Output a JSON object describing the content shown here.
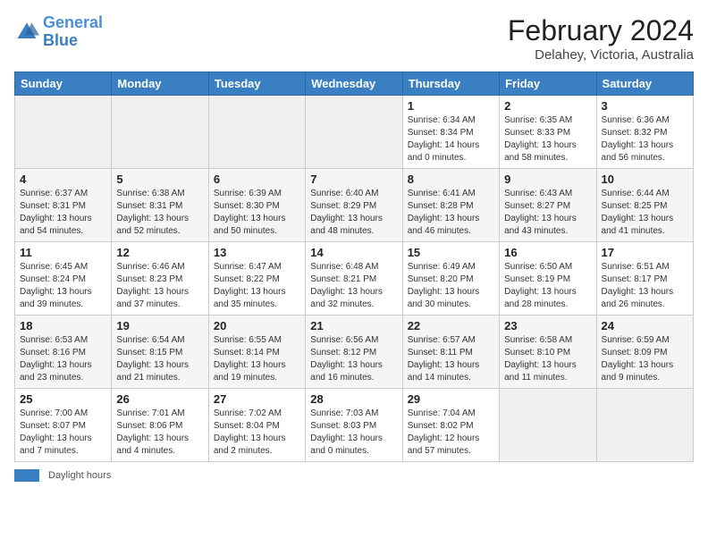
{
  "header": {
    "logo_line1": "General",
    "logo_line2": "Blue",
    "month_year": "February 2024",
    "location": "Delahey, Victoria, Australia"
  },
  "days_of_week": [
    "Sunday",
    "Monday",
    "Tuesday",
    "Wednesday",
    "Thursday",
    "Friday",
    "Saturday"
  ],
  "footer": {
    "daylight_label": "Daylight hours"
  },
  "weeks": [
    [
      {
        "num": "",
        "info": ""
      },
      {
        "num": "",
        "info": ""
      },
      {
        "num": "",
        "info": ""
      },
      {
        "num": "",
        "info": ""
      },
      {
        "num": "1",
        "info": "Sunrise: 6:34 AM\nSunset: 8:34 PM\nDaylight: 14 hours\nand 0 minutes."
      },
      {
        "num": "2",
        "info": "Sunrise: 6:35 AM\nSunset: 8:33 PM\nDaylight: 13 hours\nand 58 minutes."
      },
      {
        "num": "3",
        "info": "Sunrise: 6:36 AM\nSunset: 8:32 PM\nDaylight: 13 hours\nand 56 minutes."
      }
    ],
    [
      {
        "num": "4",
        "info": "Sunrise: 6:37 AM\nSunset: 8:31 PM\nDaylight: 13 hours\nand 54 minutes."
      },
      {
        "num": "5",
        "info": "Sunrise: 6:38 AM\nSunset: 8:31 PM\nDaylight: 13 hours\nand 52 minutes."
      },
      {
        "num": "6",
        "info": "Sunrise: 6:39 AM\nSunset: 8:30 PM\nDaylight: 13 hours\nand 50 minutes."
      },
      {
        "num": "7",
        "info": "Sunrise: 6:40 AM\nSunset: 8:29 PM\nDaylight: 13 hours\nand 48 minutes."
      },
      {
        "num": "8",
        "info": "Sunrise: 6:41 AM\nSunset: 8:28 PM\nDaylight: 13 hours\nand 46 minutes."
      },
      {
        "num": "9",
        "info": "Sunrise: 6:43 AM\nSunset: 8:27 PM\nDaylight: 13 hours\nand 43 minutes."
      },
      {
        "num": "10",
        "info": "Sunrise: 6:44 AM\nSunset: 8:25 PM\nDaylight: 13 hours\nand 41 minutes."
      }
    ],
    [
      {
        "num": "11",
        "info": "Sunrise: 6:45 AM\nSunset: 8:24 PM\nDaylight: 13 hours\nand 39 minutes."
      },
      {
        "num": "12",
        "info": "Sunrise: 6:46 AM\nSunset: 8:23 PM\nDaylight: 13 hours\nand 37 minutes."
      },
      {
        "num": "13",
        "info": "Sunrise: 6:47 AM\nSunset: 8:22 PM\nDaylight: 13 hours\nand 35 minutes."
      },
      {
        "num": "14",
        "info": "Sunrise: 6:48 AM\nSunset: 8:21 PM\nDaylight: 13 hours\nand 32 minutes."
      },
      {
        "num": "15",
        "info": "Sunrise: 6:49 AM\nSunset: 8:20 PM\nDaylight: 13 hours\nand 30 minutes."
      },
      {
        "num": "16",
        "info": "Sunrise: 6:50 AM\nSunset: 8:19 PM\nDaylight: 13 hours\nand 28 minutes."
      },
      {
        "num": "17",
        "info": "Sunrise: 6:51 AM\nSunset: 8:17 PM\nDaylight: 13 hours\nand 26 minutes."
      }
    ],
    [
      {
        "num": "18",
        "info": "Sunrise: 6:53 AM\nSunset: 8:16 PM\nDaylight: 13 hours\nand 23 minutes."
      },
      {
        "num": "19",
        "info": "Sunrise: 6:54 AM\nSunset: 8:15 PM\nDaylight: 13 hours\nand 21 minutes."
      },
      {
        "num": "20",
        "info": "Sunrise: 6:55 AM\nSunset: 8:14 PM\nDaylight: 13 hours\nand 19 minutes."
      },
      {
        "num": "21",
        "info": "Sunrise: 6:56 AM\nSunset: 8:12 PM\nDaylight: 13 hours\nand 16 minutes."
      },
      {
        "num": "22",
        "info": "Sunrise: 6:57 AM\nSunset: 8:11 PM\nDaylight: 13 hours\nand 14 minutes."
      },
      {
        "num": "23",
        "info": "Sunrise: 6:58 AM\nSunset: 8:10 PM\nDaylight: 13 hours\nand 11 minutes."
      },
      {
        "num": "24",
        "info": "Sunrise: 6:59 AM\nSunset: 8:09 PM\nDaylight: 13 hours\nand 9 minutes."
      }
    ],
    [
      {
        "num": "25",
        "info": "Sunrise: 7:00 AM\nSunset: 8:07 PM\nDaylight: 13 hours\nand 7 minutes."
      },
      {
        "num": "26",
        "info": "Sunrise: 7:01 AM\nSunset: 8:06 PM\nDaylight: 13 hours\nand 4 minutes."
      },
      {
        "num": "27",
        "info": "Sunrise: 7:02 AM\nSunset: 8:04 PM\nDaylight: 13 hours\nand 2 minutes."
      },
      {
        "num": "28",
        "info": "Sunrise: 7:03 AM\nSunset: 8:03 PM\nDaylight: 13 hours\nand 0 minutes."
      },
      {
        "num": "29",
        "info": "Sunrise: 7:04 AM\nSunset: 8:02 PM\nDaylight: 12 hours\nand 57 minutes."
      },
      {
        "num": "",
        "info": ""
      },
      {
        "num": "",
        "info": ""
      }
    ]
  ]
}
